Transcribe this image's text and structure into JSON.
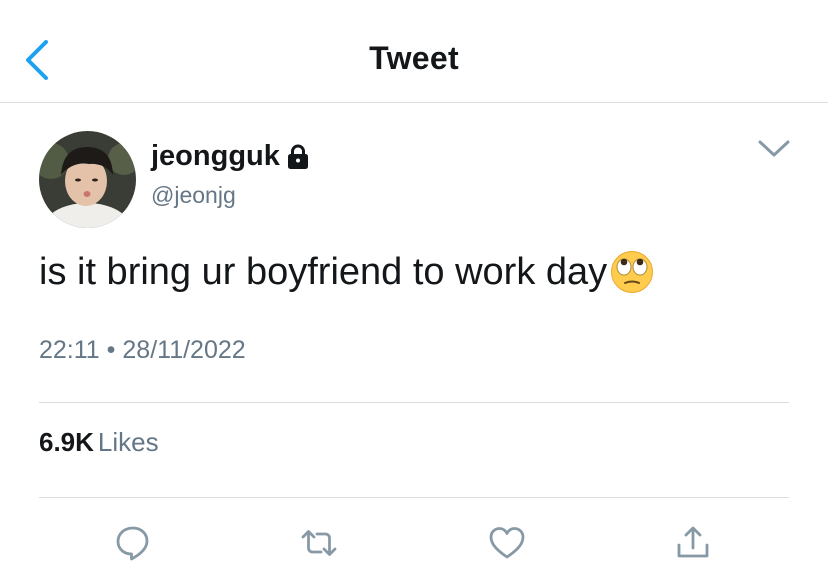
{
  "header": {
    "title": "Tweet",
    "back_icon": "chevron-left-icon"
  },
  "author": {
    "name": "jeongguk",
    "handle": "@jeonjg",
    "protected_icon": "lock-icon"
  },
  "tweet": {
    "text": "is it bring ur boyfriend to work day",
    "emoji": "face-with-rolling-eyes",
    "time": "22:11",
    "separator": "•",
    "date": "28/11/2022"
  },
  "stats": {
    "likes_count": "6.9K",
    "likes_label": "Likes"
  },
  "actions": [
    "reply-icon",
    "retweet-icon",
    "like-icon",
    "share-icon"
  ],
  "colors": {
    "accent": "#1da1f2",
    "secondary_text": "#657786",
    "icon_gray": "#8899a6"
  }
}
